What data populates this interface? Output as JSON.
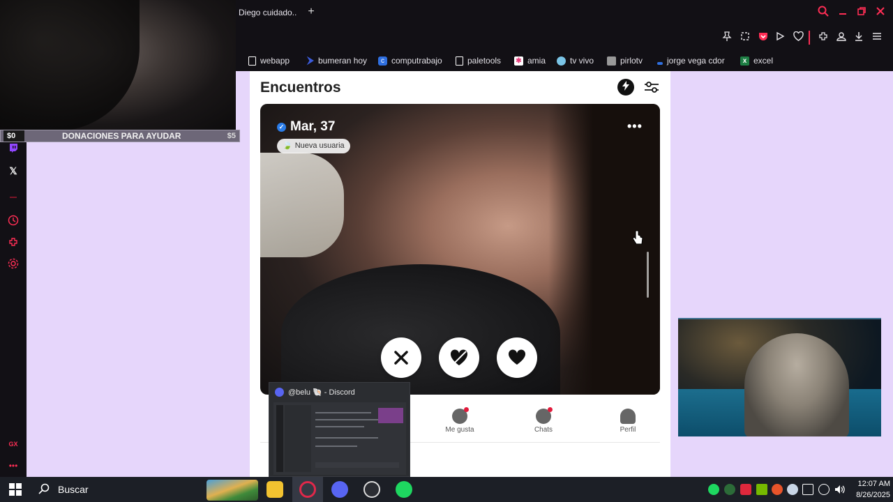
{
  "browser": {
    "active_tab_title": "Diego cuidado..",
    "new_tab_symbol": "+",
    "bookmarks": [
      {
        "label": "webapp",
        "icon": "page-icon",
        "color": "#ffffff"
      },
      {
        "label": "bumeran hoy",
        "icon": "bumeran-icon",
        "color": "#3b5bdb"
      },
      {
        "label": "computrabajo",
        "icon": "computrabajo-icon",
        "color": "#2f6fe0"
      },
      {
        "label": "paletools",
        "icon": "page-icon",
        "color": "#ffffff"
      },
      {
        "label": "amia",
        "icon": "amia-icon",
        "color": "#e63a7a"
      },
      {
        "label": "tv vivo",
        "icon": "tv-icon",
        "color": "#7ac4e6"
      },
      {
        "label": "pirlotv",
        "icon": "pirlo-icon",
        "color": "#999999"
      },
      {
        "label": "jorge vega cdor",
        "icon": "jorge-icon",
        "color": "#2f6fe0"
      },
      {
        "label": "excel",
        "icon": "excel-icon",
        "color": "#1e7e44"
      }
    ]
  },
  "overlay": {
    "donation_left": "$0",
    "donation_title": "DONACIONES PARA AYUDAR",
    "donation_right": "$5"
  },
  "app": {
    "title": "Encuentros",
    "profile": {
      "name": "Mar, 37",
      "badge": "Nueva usuaria"
    },
    "nav": [
      {
        "label": "Me gusta",
        "icon": "heart-chat-icon",
        "dot": true
      },
      {
        "label": "Chats",
        "icon": "chat-icon",
        "dot": true
      },
      {
        "label": "Perfil",
        "icon": "person-icon",
        "dot": false
      }
    ]
  },
  "discord_preview": {
    "title": "@belu 🐚 - Discord"
  },
  "taskbar": {
    "search_label": "Buscar",
    "time": "12:07 AM",
    "date": "8/26/2025"
  },
  "colors": {
    "accent": "#ff2e55",
    "page_bg": "#e6d6fb"
  }
}
